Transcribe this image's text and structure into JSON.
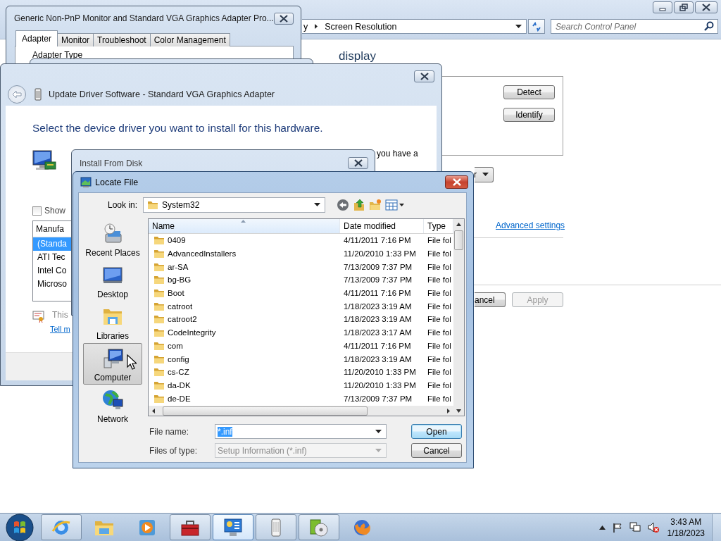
{
  "control_panel": {
    "breadcrumb": [
      "y",
      "Screen Resolution"
    ],
    "search": {
      "placeholder": "Search Control Panel"
    },
    "heading": "display",
    "buttons": [
      "Detect",
      "Identify"
    ],
    "dropdown": "r",
    "link": "Advanced settings",
    "footer_buttons": [
      {
        "label": "ancel",
        "disabled": false
      },
      {
        "label": "Apply",
        "disabled": true
      }
    ]
  },
  "properties": {
    "title": "Generic Non-PnP Monitor and Standard VGA Graphics Adapter Pro...",
    "tabs": [
      {
        "label": "Adapter",
        "selected": true
      },
      {
        "label": "Monitor",
        "selected": false
      },
      {
        "label": "Troubleshoot",
        "selected": false
      },
      {
        "label": "Color Management",
        "selected": false
      }
    ],
    "group_label": "Adapter Type"
  },
  "update_driver": {
    "title": "Update Driver Software - Standard VGA Graphics Adapter",
    "heading": "Select the device driver you want to install for this hardware.",
    "text": "you have a",
    "checkbox": {
      "label": "Show",
      "checked": false
    },
    "list": {
      "header": "Manufa",
      "items": [
        {
          "label": "(Standa",
          "selected": true
        },
        {
          "label": "ATI Tec",
          "selected": false
        },
        {
          "label": "Intel Co",
          "selected": false
        },
        {
          "label": "Microso",
          "selected": false
        }
      ]
    },
    "note": "This",
    "link": "Tell m"
  },
  "install_from_disk": {
    "title": "Install From Disk"
  },
  "locate_file": {
    "title": "Locate File",
    "look_in_label": "Look in:",
    "look_in": "System32",
    "places": [
      {
        "label": "Recent Places",
        "kind": "recent",
        "selected": false
      },
      {
        "label": "Desktop",
        "kind": "desktop",
        "selected": false
      },
      {
        "label": "Libraries",
        "kind": "libraries",
        "selected": false
      },
      {
        "label": "Computer",
        "kind": "computer",
        "selected": true
      },
      {
        "label": "Network",
        "kind": "network",
        "selected": false
      }
    ],
    "columns": [
      "Name",
      "Date modified",
      "Type"
    ],
    "rows": [
      {
        "name": "0409",
        "date": "4/11/2011 7:16 PM",
        "type": "File fol",
        "selected": false
      },
      {
        "name": "AdvancedInstallers",
        "date": "11/20/2010 1:33 PM",
        "type": "File fol",
        "selected": false
      },
      {
        "name": "ar-SA",
        "date": "7/13/2009 7:37 PM",
        "type": "File fol",
        "selected": false
      },
      {
        "name": "bg-BG",
        "date": "7/13/2009 7:37 PM",
        "type": "File fol",
        "selected": false
      },
      {
        "name": "Boot",
        "date": "4/11/2011 7:16 PM",
        "type": "File fol",
        "selected": false
      },
      {
        "name": "catroot",
        "date": "1/18/2023 3:19 AM",
        "type": "File fol",
        "selected": false
      },
      {
        "name": "catroot2",
        "date": "1/18/2023 3:19 AM",
        "type": "File fol",
        "selected": false
      },
      {
        "name": "CodeIntegrity",
        "date": "1/18/2023 3:17 AM",
        "type": "File fol",
        "selected": false
      },
      {
        "name": "com",
        "date": "4/11/2011 7:16 PM",
        "type": "File fol",
        "selected": false
      },
      {
        "name": "config",
        "date": "1/18/2023 3:19 AM",
        "type": "File fol",
        "selected": false
      },
      {
        "name": "cs-CZ",
        "date": "11/20/2010 1:33 PM",
        "type": "File fol",
        "selected": false
      },
      {
        "name": "da-DK",
        "date": "11/20/2010 1:33 PM",
        "type": "File fol",
        "selected": false
      },
      {
        "name": "de-DE",
        "date": "7/13/2009 7:37 PM",
        "type": "File fol",
        "selected": false
      }
    ],
    "file_name_label": "File name:",
    "file_name": {
      "value": "*.inf",
      "selected": true
    },
    "file_type_label": "Files of type:",
    "file_type": {
      "value": "Setup Information (*.inf)",
      "disabled": true
    },
    "buttons": [
      {
        "label": "Open",
        "default": true
      },
      {
        "label": "Cancel",
        "default": false
      }
    ]
  },
  "taskbar": {
    "apps": [
      {
        "kind": "browser",
        "running": true,
        "selected": false
      },
      {
        "kind": "explorer",
        "running": false,
        "selected": false
      },
      {
        "kind": "media",
        "running": false,
        "selected": false
      },
      {
        "kind": "toolbox",
        "running": true,
        "selected": false
      },
      {
        "kind": "control-panel",
        "running": true,
        "selected": true
      },
      {
        "kind": "device",
        "running": true,
        "selected": false
      },
      {
        "kind": "installer",
        "running": true,
        "selected": false
      },
      {
        "kind": "firefox",
        "running": false,
        "selected": false
      }
    ],
    "clock": {
      "time": "3:43 AM",
      "date": "1/18/2023"
    }
  }
}
